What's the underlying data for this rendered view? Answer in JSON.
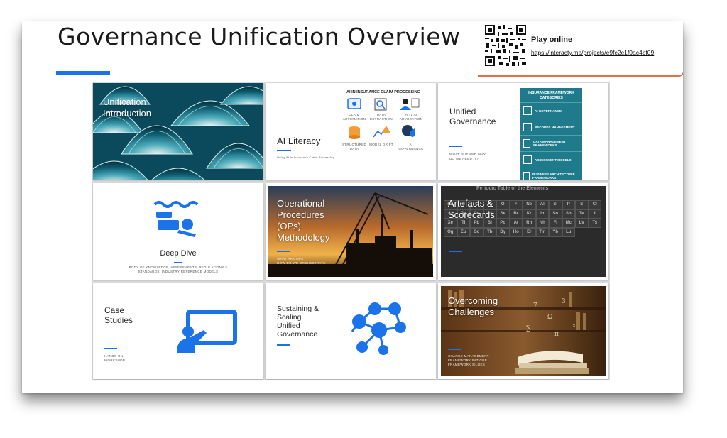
{
  "slide": {
    "title": "Governance Unification Overview",
    "play": {
      "label": "Play online",
      "url": "https://interacty.me/projects/e9fc2e1f0ac4bf09"
    }
  },
  "tiles": {
    "unification": {
      "title_line1": "Unification",
      "title_line2": "Introduction"
    },
    "ai_literacy": {
      "title": "AI Literacy",
      "subtitle": "Using AI in Insurance Claim Processing",
      "diagram_title": "AI IN INSURANCE CLAIM PROCESSING",
      "items": [
        "CLAIM AUTOMATION",
        "DATA EXTRACTION",
        "HITL AI ADVOCATION",
        "STRUCTURED DATA",
        "MODEL DRIFT",
        "AI GOVERNANCE"
      ]
    },
    "unified_governance": {
      "title_line1": "Unified",
      "title_line2": "Governance",
      "tagline_line1": "WHAT IS IT AND WHY",
      "tagline_line2": "DO WE NEED IT?",
      "panel_title": "INSURANCE FRAMEWORK CATEGORIES",
      "panel_items": [
        "AI GOVERNANCE",
        "RECORDS MANAGEMENT",
        "DATA MANAGEMENT FRAMEWORKS",
        "ASSESSMENT MODELS",
        "BUSINESS ARCHITECTURE FRAMEWORKS"
      ]
    },
    "deep_dive": {
      "title": "Deep Dive",
      "caption_line1": "BODY OF KNOWLEDGE, ASSESSMENTS, REGULATIONS &",
      "caption_line2": "STANDARDS, INDUSTRY REFERENCE MODELS"
    },
    "operational": {
      "title_line1": "Operational",
      "title_line2": "Procedures",
      "title_line3": "(OPs)",
      "title_line4": "Methodology",
      "caption_line1": "WHAT ARE OPS",
      "caption_line2": "HOW DO WE ORCHESTRATE"
    },
    "artefacts": {
      "title_line1": "Artefacts &",
      "title_line2": "Scorecards",
      "backdrop_heading": "Periodic Table of the Elements",
      "elements": [
        "He",
        "B",
        "C",
        "N",
        "O",
        "F",
        "Ne",
        "Al",
        "Si",
        "P",
        "S",
        "Cl",
        "Ar",
        "Ga",
        "Ge",
        "As",
        "Se",
        "Br",
        "Kr",
        "In",
        "Sn",
        "Sb",
        "Te",
        "I",
        "Xe",
        "Tl",
        "Pb",
        "Bi",
        "Po",
        "At",
        "Rn",
        "Nh",
        "Fl",
        "Mc",
        "Lv",
        "Ts",
        "Og",
        "Eu",
        "Gd",
        "Tb",
        "Dy",
        "Ho",
        "Er",
        "Tm",
        "Yb",
        "Lu"
      ]
    },
    "case_studies": {
      "title_line1": "Case",
      "title_line2": "Studies",
      "caption_line1": "HANDS-ON",
      "caption_line2": "WORKSHOP"
    },
    "sustaining": {
      "title_line1": "Sustaining &",
      "title_line2": "Scaling",
      "title_line3": "Unified",
      "title_line4": "Governance"
    },
    "overcoming": {
      "title_line1": "Overcoming",
      "title_line2": "Challenges",
      "caption_line1": "CHANGE MANAGEMENT",
      "caption_line2": "FRAMEWORK FATIGUE",
      "caption_line3": "FRAMEWORK SILOES"
    }
  },
  "colors": {
    "accent": "#1a73e8",
    "teal_panel": "#1f7a8c",
    "card_border": "#e0704a"
  }
}
